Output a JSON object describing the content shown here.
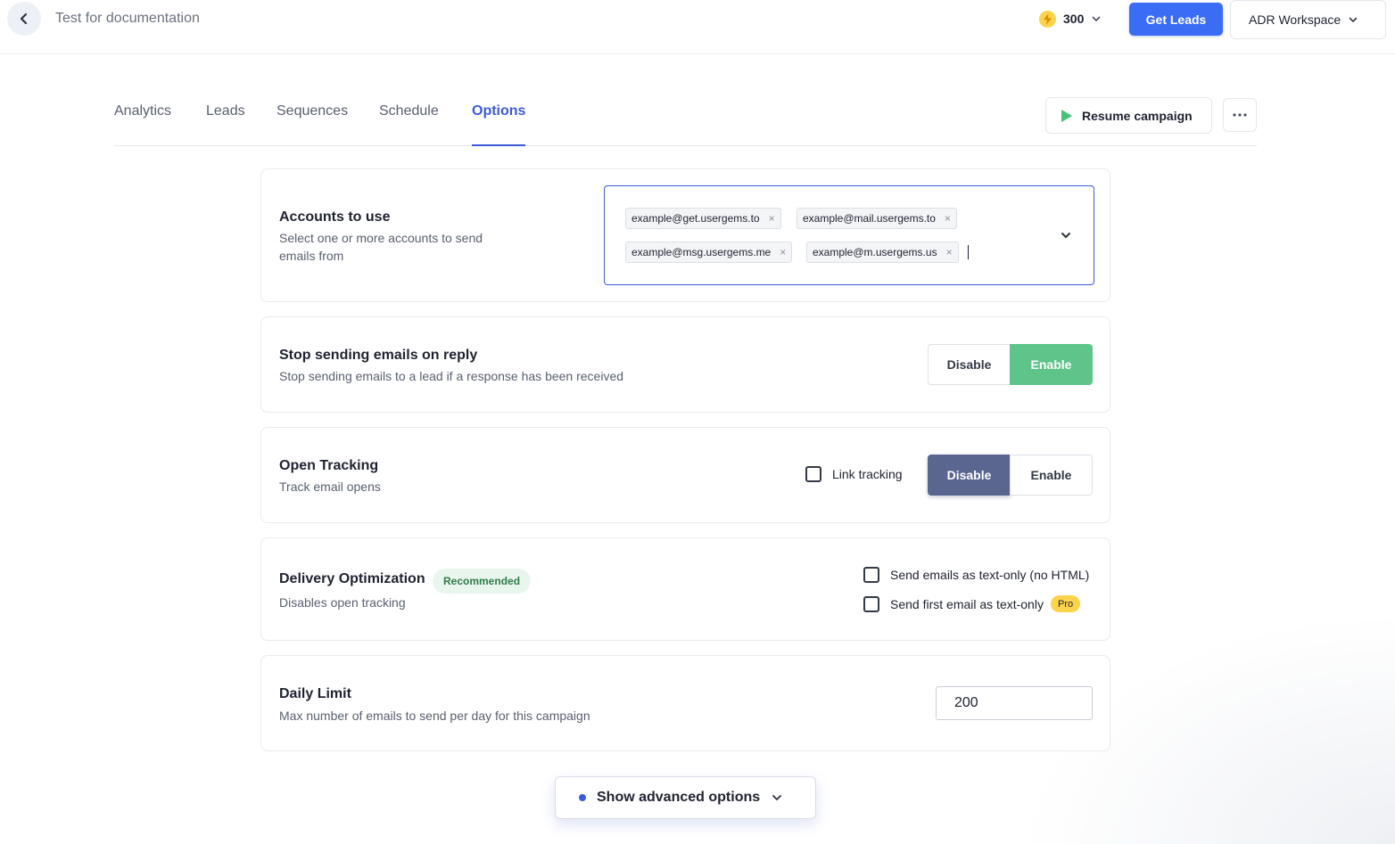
{
  "header": {
    "back_icon": "chevron-left-icon",
    "page_name": "Test for documentation",
    "credits": "300",
    "credits_icon": "bolt-icon",
    "get_leads_label": "Get Leads",
    "workspace_label": "ADR Workspace"
  },
  "tabs": [
    {
      "label": "Analytics"
    },
    {
      "label": "Leads"
    },
    {
      "label": "Sequences"
    },
    {
      "label": "Schedule"
    },
    {
      "label": "Options",
      "active": true
    }
  ],
  "actions": {
    "resume_label": "Resume campaign",
    "more_icon": "ellipsis-icon"
  },
  "accounts": {
    "title": "Accounts to use",
    "description": "Select one or more accounts to send emails from",
    "selected": [
      "example@get.usergems.to",
      "example@mail.usergems.to",
      "example@msg.usergems.me",
      "example@m.usergems.us"
    ],
    "remove_glyph": "×"
  },
  "stop_on_reply": {
    "title": "Stop sending emails on reply",
    "description": "Stop sending emails to a lead if a response has been received",
    "disable_label": "Disable",
    "enable_label": "Enable",
    "state": "Enable"
  },
  "open_tracking": {
    "title": "Open Tracking",
    "description": "Track email opens",
    "link_tracking_label": "Link tracking",
    "link_tracking_checked": false,
    "disable_label": "Disable",
    "enable_label": "Enable",
    "state": "Disable"
  },
  "delivery": {
    "title": "Delivery Optimization",
    "badge": "Recommended",
    "description": "Disables open tracking",
    "text_only_label": "Send emails as text-only (no HTML)",
    "first_text_only_label": "Send first email as text-only",
    "pro_badge": "Pro"
  },
  "daily_limit": {
    "title": "Daily Limit",
    "description": "Max number of emails to send per day for this campaign",
    "value": "200"
  },
  "advanced": {
    "label": "Show advanced options"
  },
  "colors": {
    "primary": "#3b6cf6",
    "active_tab": "#3b5bdb",
    "enable_green": "#5ec48a",
    "disable_slate": "#5a6690",
    "pro_yellow": "#fcd34d"
  }
}
